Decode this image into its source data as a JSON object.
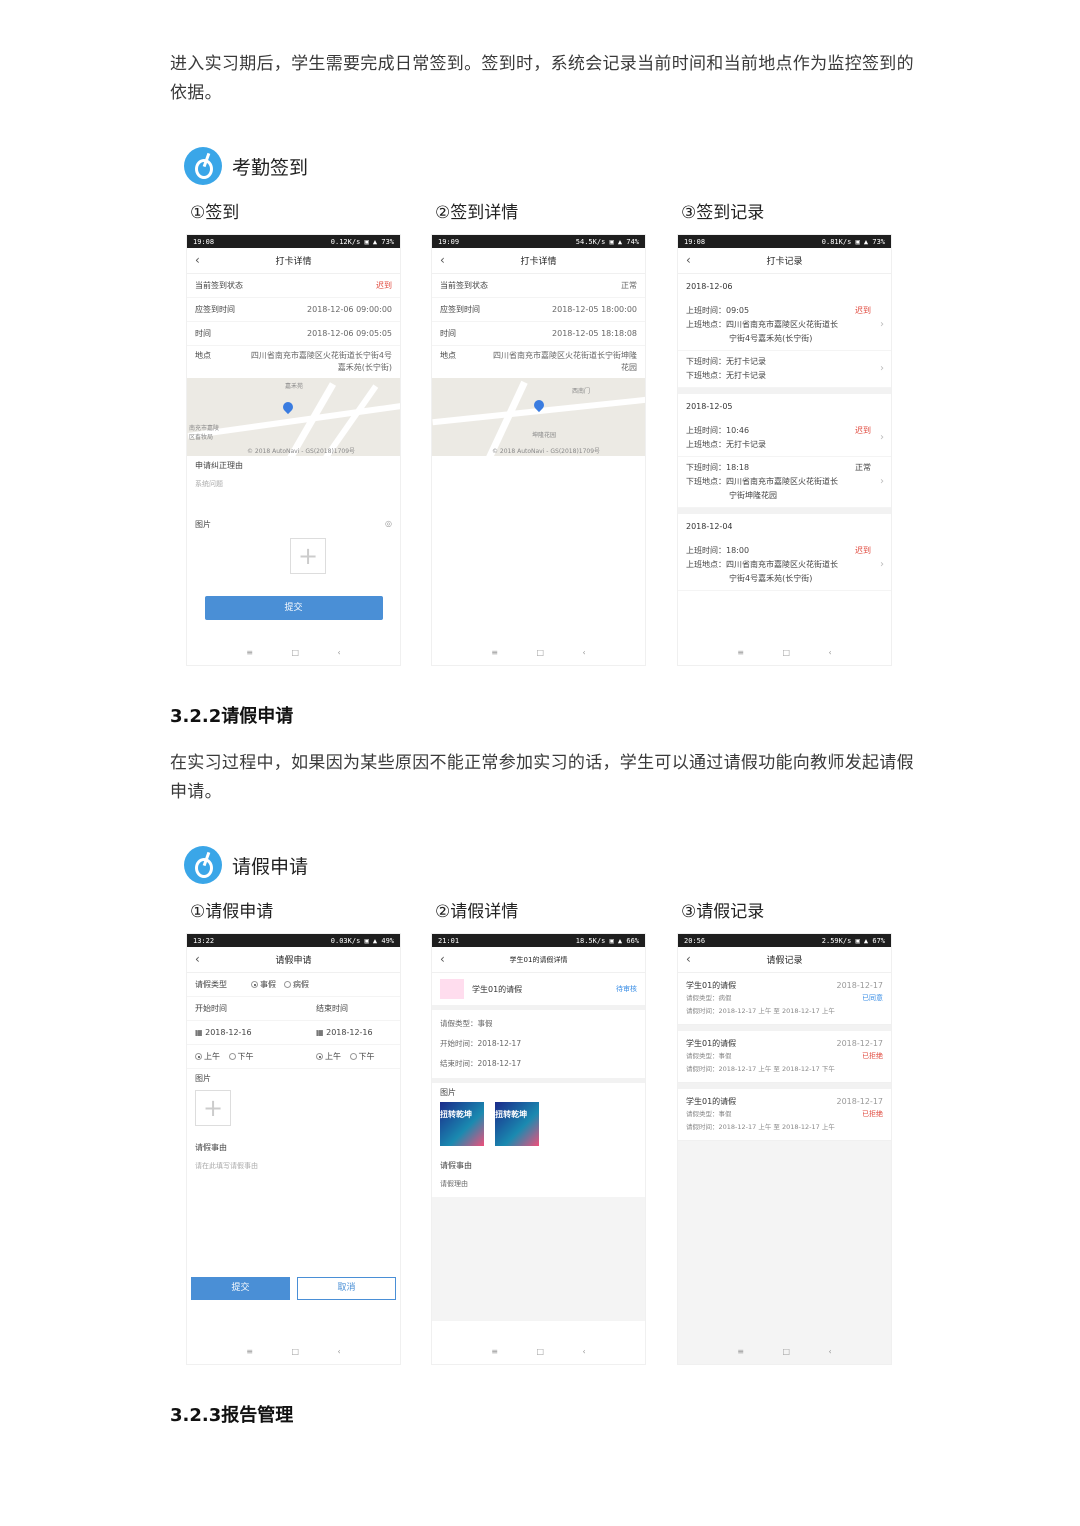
{
  "intro1": "进入实习期后，学生需要完成日常签到。签到时，系统会记录当前时间和当前地点作为监控签到的依据。",
  "figure1": {
    "title": "考勤签到",
    "col1": "①签到",
    "col2": "②签到详情",
    "col3": "③签到记录",
    "phone1": {
      "status_time": "19:08",
      "status_right": "0.12K/s ▣ ▲ 73%",
      "nav_title": "打卡详情",
      "rows": [
        {
          "label": "当前签到状态",
          "value": "迟到"
        },
        {
          "label": "应签到时间",
          "value": "2018-12-06 09:00:00"
        },
        {
          "label": "时间",
          "value": "2018-12-06 09:05:05"
        }
      ],
      "addr_label": "地点",
      "addr_value": "四川省南充市嘉陵区火花街道长宁街4号嘉禾苑(长宁街)",
      "map_t1": "嘉禾苑",
      "map_t2": "南充市嘉陵区畜牧局",
      "map_t3": "© 2018 AutoNavi - GS(2018)1709号",
      "reason_label": "申请纠正理由",
      "reason_hint": "系统问题",
      "image_label": "图片",
      "submit": "提交"
    },
    "phone2": {
      "status_time": "19:09",
      "status_right": "54.5K/s ▣ ▲ 74%",
      "nav_title": "打卡详情",
      "rows": [
        {
          "label": "当前签到状态",
          "value": "正常"
        },
        {
          "label": "应签到时间",
          "value": "2018-12-05 18:00:00"
        },
        {
          "label": "时间",
          "value": "2018-12-05 18:18:08"
        }
      ],
      "addr_label": "地点",
      "addr_value": "四川省南充市嘉陵区火花街道长宁街坤隆花园",
      "map_t1": "西南门",
      "map_t2": "坤隆花园",
      "map_t3": "© 2018 AutoNavi - GS(2018)1709号"
    },
    "phone3": {
      "status_time": "19:08",
      "status_right": "0.81K/s ▣ ▲ 73%",
      "nav_title": "打卡记录",
      "days": [
        {
          "date": "2018-12-06",
          "recs": [
            {
              "l1": "上班时间：09:05",
              "status": "迟到",
              "l2": "上班地点：四川省南充市嘉陵区火花街道长",
              "l3": "宁街4号嘉禾苑(长宁街)"
            },
            {
              "l1": "下班时间：无打卡记录",
              "status": "",
              "l2": "下班地点：无打卡记录",
              "l3": ""
            }
          ]
        },
        {
          "date": "2018-12-05",
          "recs": [
            {
              "l1": "上班时间：10:46",
              "status": "迟到",
              "l2": "上班地点：无打卡记录",
              "l3": ""
            },
            {
              "l1": "下班时间：18:18",
              "status": "正常",
              "l2": "下班地点：四川省南充市嘉陵区火花街道长",
              "l3": "宁街坤隆花园"
            }
          ]
        },
        {
          "date": "2018-12-04",
          "recs": [
            {
              "l1": "上班时间：18:00",
              "status": "迟到",
              "l2": "上班地点：四川省南充市嘉陵区火花街道长",
              "l3": "宁街4号嘉禾苑(长宁街)"
            }
          ]
        }
      ]
    }
  },
  "heading322": "3.2.2请假申请",
  "intro2": "在实习过程中，如果因为某些原因不能正常参加实习的话，学生可以通过请假功能向教师发起请假申请。",
  "figure2": {
    "title": "请假申请",
    "col1": "①请假申请",
    "col2": "②请假详情",
    "col3": "③请假记录",
    "phone1": {
      "status_time": "13:22",
      "status_right": "0.03K/s ▣ ▲ 49%",
      "nav_title": "请假申请",
      "type_label": "请假类型",
      "type_opt1": "事假",
      "type_opt2": "病假",
      "start_label": "开始时间",
      "end_label": "结束时间",
      "start_date": "2018-12-16",
      "end_date": "2018-12-16",
      "am": "上午",
      "pm": "下午",
      "image_label": "图片",
      "reason_label": "请假事由",
      "reason_hint": "请在此填写请假事由",
      "submit": "提交",
      "cancel": "取消"
    },
    "phone2": {
      "status_time": "21:01",
      "status_right": "18.5K/s ▣ ▲ 66%",
      "nav_title": "学生01的请假详情",
      "header_name": "学生01的请假",
      "header_status": "待审核",
      "type": "请假类型：事假",
      "start": "开始时间：2018-12-17",
      "end": "结束时间：2018-12-17",
      "image_label": "图片",
      "thumb_text": "扭转乾坤",
      "reason_label": "请假事由",
      "reason_value": "请假理由"
    },
    "phone3": {
      "status_time": "20:56",
      "status_right": "2.59K/s ▣ ▲ 67%",
      "nav_title": "请假记录",
      "cards": [
        {
          "name": "学生01的请假",
          "date": "2018-12-17",
          "type": "请假类型：病假",
          "status": "已同意",
          "time": "请假时间：2018-12-17 上午 至 2018-12-17 上午"
        },
        {
          "name": "学生01的请假",
          "date": "2018-12-17",
          "type": "请假类型：事假",
          "status": "已拒绝",
          "time": "请假时间：2018-12-17 上午 至 2018-12-17 下午"
        },
        {
          "name": "学生01的请假",
          "date": "2018-12-17",
          "type": "请假类型：事假",
          "status": "已拒绝",
          "time": "请假时间：2018-12-17 上午 至 2018-12-17 上午"
        }
      ]
    }
  },
  "heading323": "3.2.3报告管理",
  "android_nav": {
    "menu": "≡",
    "home": "□",
    "back": "‹"
  }
}
